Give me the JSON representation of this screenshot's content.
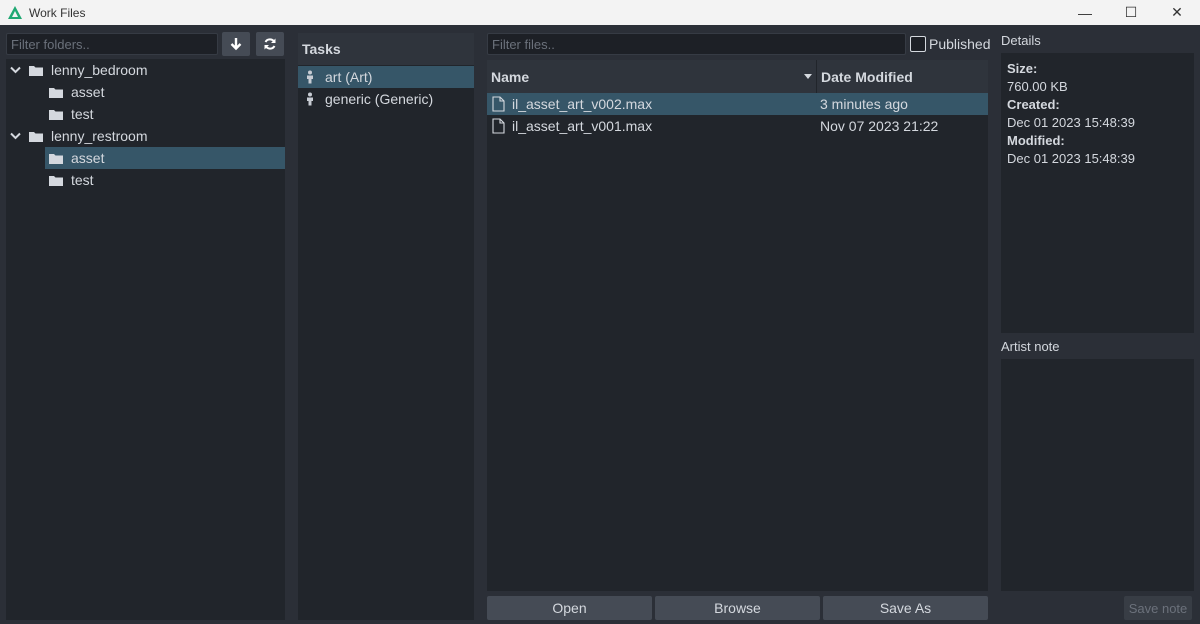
{
  "window": {
    "title": "Work Files",
    "minimize_glyph": "—",
    "maximize_glyph": "☐",
    "close_glyph": "✕"
  },
  "folders": {
    "filter_placeholder": "Filter folders..",
    "tree": [
      {
        "label": "lenny_bedroom",
        "expanded": true
      },
      {
        "label": "asset"
      },
      {
        "label": "test"
      },
      {
        "label": "lenny_restroom",
        "expanded": true
      },
      {
        "label": "asset",
        "selected": true
      },
      {
        "label": "test"
      }
    ]
  },
  "tasks": {
    "header": "Tasks",
    "items": [
      {
        "label": "art (Art)",
        "selected": true
      },
      {
        "label": "generic (Generic)"
      }
    ]
  },
  "files": {
    "filter_placeholder": "Filter files..",
    "published_label": "Published",
    "columns": {
      "name": "Name",
      "date": "Date Modified"
    },
    "rows": [
      {
        "name": "il_asset_art_v002.max",
        "date": "3 minutes ago",
        "selected": true
      },
      {
        "name": "il_asset_art_v001.max",
        "date": "Nov 07 2023 21:22"
      }
    ],
    "buttons": {
      "open": "Open",
      "browse": "Browse",
      "save_as": "Save As"
    }
  },
  "details": {
    "header": "Details",
    "size_label": "Size:",
    "size_value": "760.00 KB",
    "created_label": "Created:",
    "created_value": "Dec 01 2023 15:48:39",
    "modified_label": "Modified:",
    "modified_value": "Dec 01 2023 15:48:39",
    "artist_note_header": "Artist note",
    "save_note_label": "Save note"
  },
  "colors": {
    "selection": "#365668",
    "panel": "#21252b",
    "background": "#2b2f37",
    "accent": "#1fa873"
  }
}
